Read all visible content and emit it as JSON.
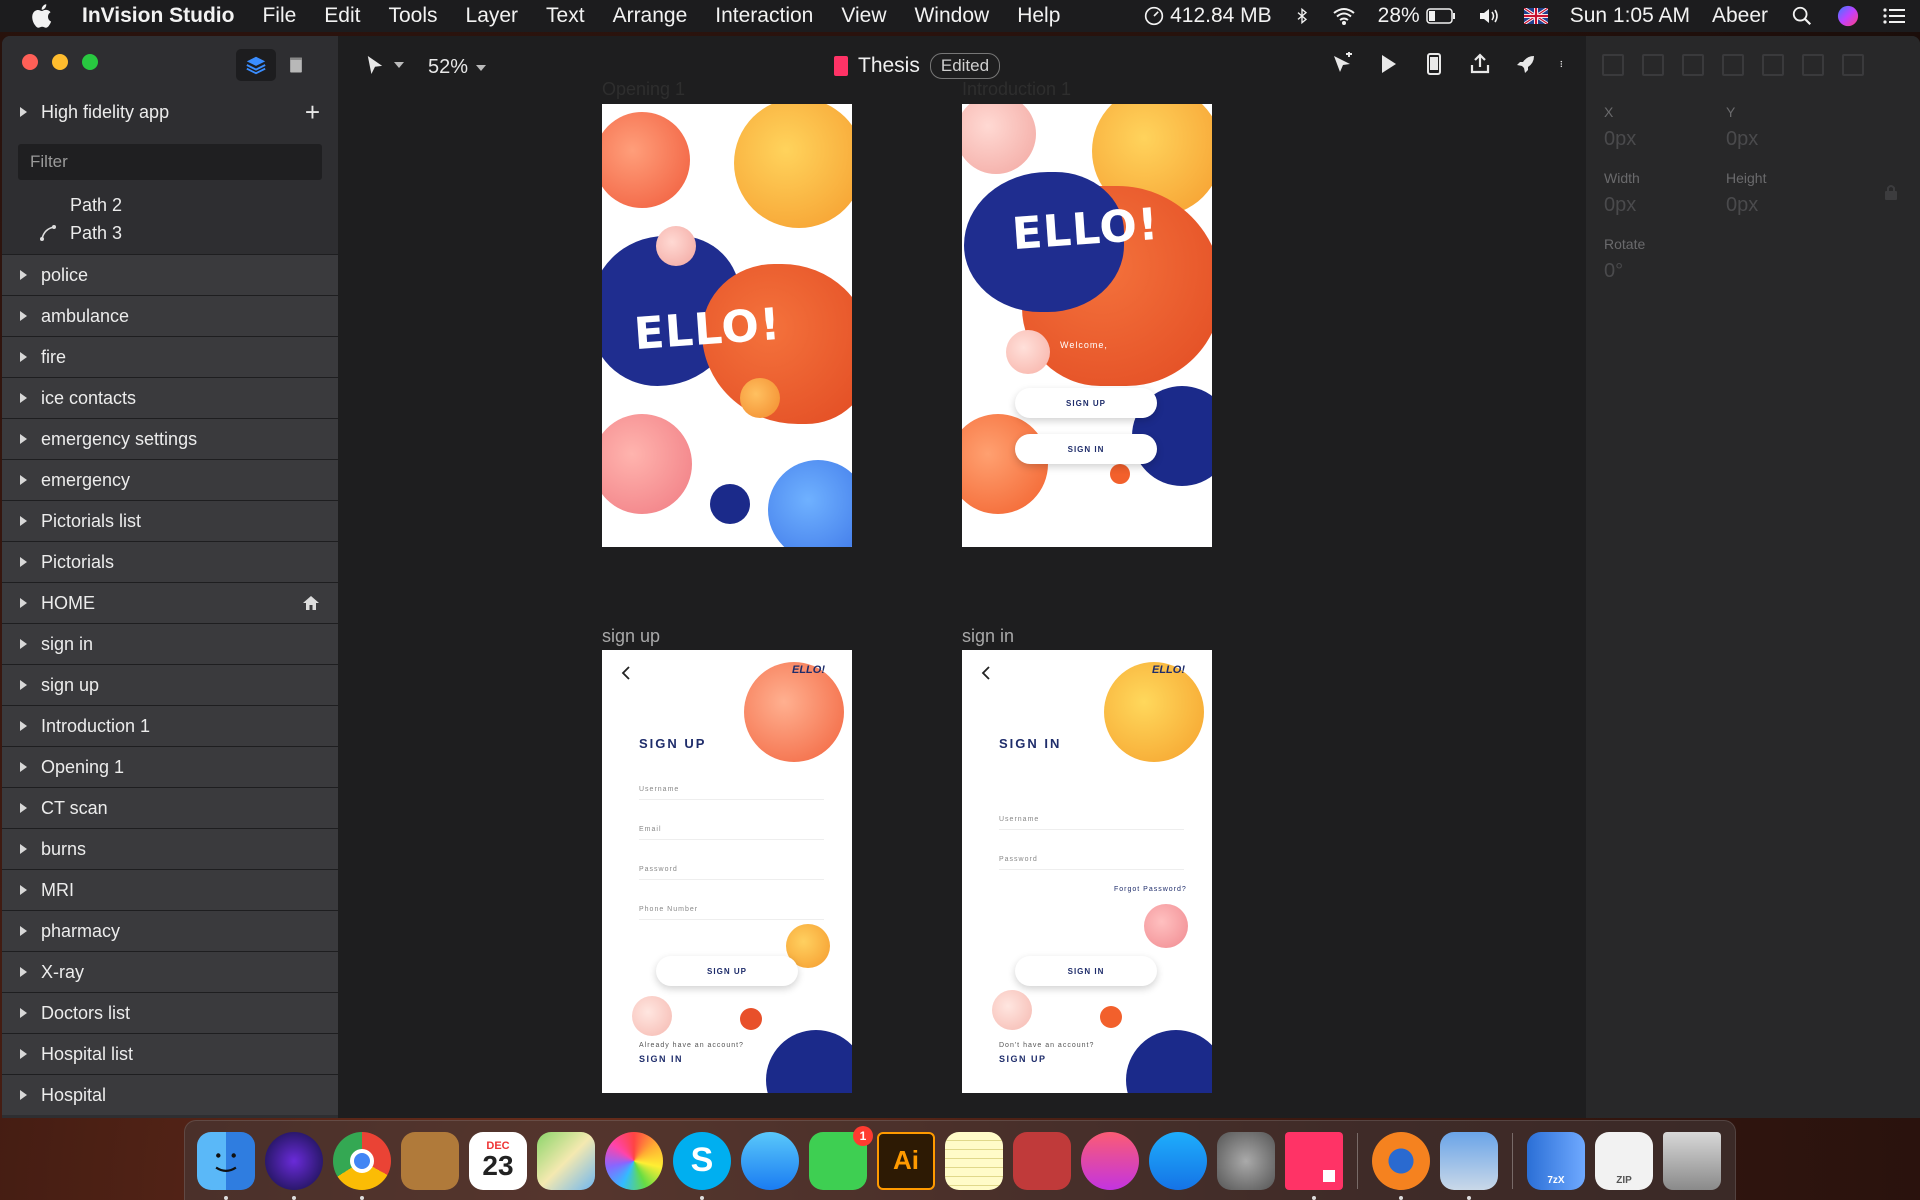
{
  "menubar": {
    "app_name": "InVision Studio",
    "menus": [
      "File",
      "Edit",
      "Tools",
      "Layer",
      "Text",
      "Arrange",
      "Interaction",
      "View",
      "Window",
      "Help"
    ],
    "memory": "412.84 MB",
    "battery": "28%",
    "clock": "Sun 1:05 AM",
    "user": "Abeer"
  },
  "sidebar": {
    "project": "High fidelity app",
    "filter_placeholder": "Filter",
    "paths": [
      "Path 2",
      "Path 3"
    ],
    "layers": [
      "police",
      "ambulance",
      "fire",
      "ice contacts",
      "emergency settings",
      "emergency",
      "Pictorials list",
      "Pictorials",
      "HOME",
      "sign in",
      "sign up",
      "Introduction 1",
      "Opening 1",
      "CT scan",
      "burns",
      "MRI",
      "pharmacy",
      "X-ray",
      "Doctors list",
      "Hospital list",
      "Hospital"
    ]
  },
  "toolbar": {
    "zoom": "52%",
    "doc_name": "Thesis",
    "doc_status": "Edited"
  },
  "artboards": {
    "opening_label": "Opening 1",
    "intro_label": "Introduction 1",
    "signup_label": "sign up",
    "signin_label": "sign in",
    "logo": "ELLO!",
    "welcome": "Welcome,",
    "btn_signup": "SIGN UP",
    "btn_signin": "SIGN IN",
    "signup_title": "SIGN UP",
    "signin_title": "SIGN IN",
    "field_username": "Username",
    "field_email": "Email",
    "field_password": "Password",
    "field_phone": "Phone Number",
    "already": "Already have an account?",
    "dont_have": "Don't have an account?",
    "forgot": "Forgot Password?"
  },
  "inspector": {
    "x_label": "X",
    "y_label": "Y",
    "x_val": "0px",
    "y_val": "0px",
    "w_label": "Width",
    "h_label": "Height",
    "w_val": "0px",
    "h_val": "0px",
    "rotate_label": "Rotate",
    "rotate_val": "0°"
  },
  "dock": {
    "calendar_month": "DEC",
    "calendar_day": "23",
    "facetime_badge": "1",
    "illustrator": "Ai",
    "zip_label": "ZIP",
    "sevenz_label": "7zX"
  },
  "colors": {
    "accent_pink": "#ff3366",
    "brand_blue": "#1f2d8f",
    "brand_orange": "#f26a3a"
  }
}
